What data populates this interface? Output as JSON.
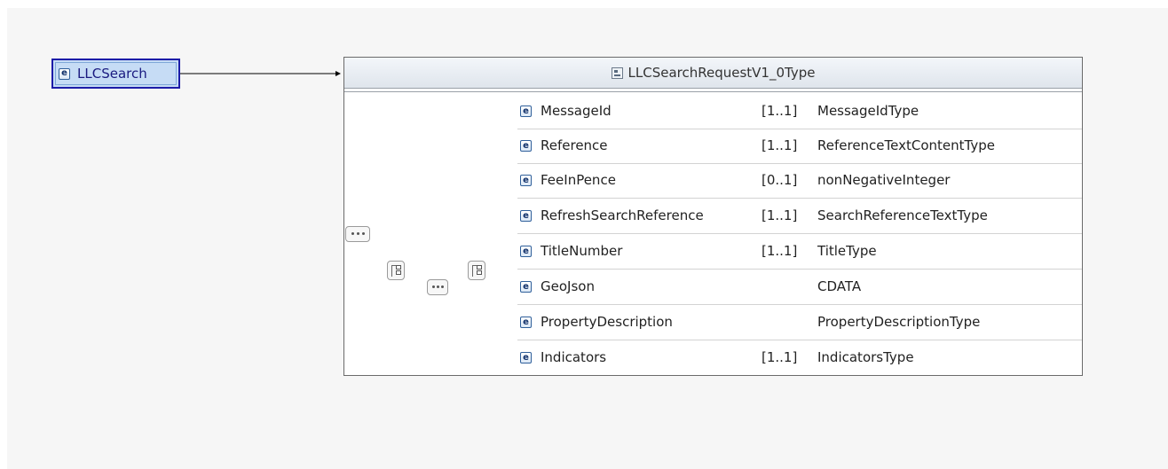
{
  "root_element": {
    "label": "LLCSearch",
    "icon": "element-icon"
  },
  "complex_type": {
    "title": "LLCSearchRequestV1_0Type",
    "icon": "complex-type-icon"
  },
  "children": [
    {
      "name": "MessageId",
      "cardinality": "[1..1]",
      "type": "MessageIdType"
    },
    {
      "name": "Reference",
      "cardinality": "[1..1]",
      "type": "ReferenceTextContentType"
    },
    {
      "name": "FeeInPence",
      "cardinality": "[0..1]",
      "type": "nonNegativeInteger"
    },
    {
      "name": "RefreshSearchReference",
      "cardinality": "[1..1]",
      "type": "SearchReferenceTextType"
    },
    {
      "name": "TitleNumber",
      "cardinality": "[1..1]",
      "type": "TitleType"
    },
    {
      "name": "GeoJson",
      "cardinality": "",
      "type": "CDATA"
    },
    {
      "name": "PropertyDescription",
      "cardinality": "",
      "type": "PropertyDescriptionType"
    },
    {
      "name": "Indicators",
      "cardinality": "[1..1]",
      "type": "IndicatorsType"
    }
  ],
  "colors": {
    "root_border": "#1c1ca8",
    "root_fill": "#c6dcf5",
    "header_fill": "#e6ebf1",
    "line": "#8c8c8c"
  }
}
